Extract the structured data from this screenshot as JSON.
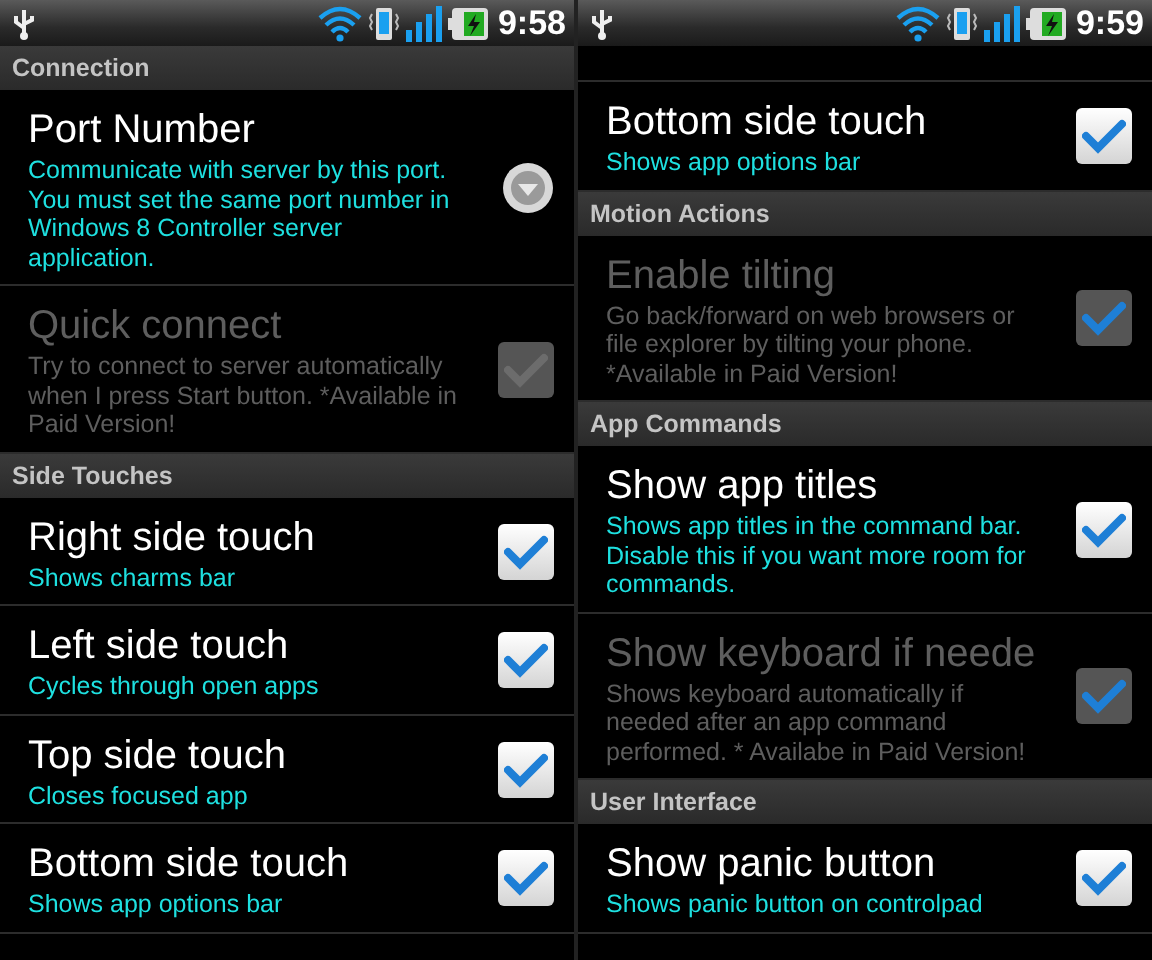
{
  "panels": [
    {
      "status_bar": {
        "time": "9:58"
      },
      "items": [
        {
          "kind": "header",
          "label": "Connection"
        },
        {
          "kind": "dropdown",
          "title": "Port Number",
          "summary": "Communicate with server by this port. You must set the same port number in Windows 8 Controller server application.",
          "disabled": false
        },
        {
          "kind": "checkbox",
          "title": "Quick connect",
          "summary": "Try to connect to server automatically when I press Start button. *Available in Paid Version!",
          "checked": false,
          "disabled": true
        },
        {
          "kind": "header",
          "label": "Side Touches"
        },
        {
          "kind": "checkbox",
          "title": "Right side touch",
          "summary": "Shows charms bar",
          "checked": true,
          "disabled": false
        },
        {
          "kind": "checkbox",
          "title": "Left side touch",
          "summary": "Cycles through open apps",
          "checked": true,
          "disabled": false
        },
        {
          "kind": "checkbox",
          "title": "Top side touch",
          "summary": "Closes focused app",
          "checked": true,
          "disabled": false
        },
        {
          "kind": "checkbox",
          "title": "Bottom side touch",
          "summary": "Shows app options bar",
          "checked": true,
          "disabled": false
        }
      ]
    },
    {
      "status_bar": {
        "time": "9:59"
      },
      "items": [
        {
          "kind": "partial"
        },
        {
          "kind": "checkbox",
          "title": "Bottom side touch",
          "summary": "Shows app options bar",
          "checked": true,
          "disabled": false
        },
        {
          "kind": "header",
          "label": "Motion Actions"
        },
        {
          "kind": "checkbox",
          "title": "Enable tilting",
          "summary": "Go back/forward on web browsers or file explorer by tilting your phone. *Available in Paid Version!",
          "checked": true,
          "disabled": true
        },
        {
          "kind": "header",
          "label": "App Commands"
        },
        {
          "kind": "checkbox",
          "title": "Show app titles",
          "summary": "Shows app titles in the command bar. Disable this if you want more room for commands.",
          "checked": true,
          "disabled": false
        },
        {
          "kind": "checkbox",
          "title": "Show keyboard if neede",
          "summary": "Shows keyboard automatically if needed after an app command performed. * Availabe in Paid Version!",
          "checked": true,
          "disabled": true
        },
        {
          "kind": "header",
          "label": "User Interface"
        },
        {
          "kind": "checkbox",
          "title": "Show panic button",
          "summary": "Shows panic button on controlpad",
          "checked": true,
          "disabled": false
        }
      ]
    }
  ]
}
